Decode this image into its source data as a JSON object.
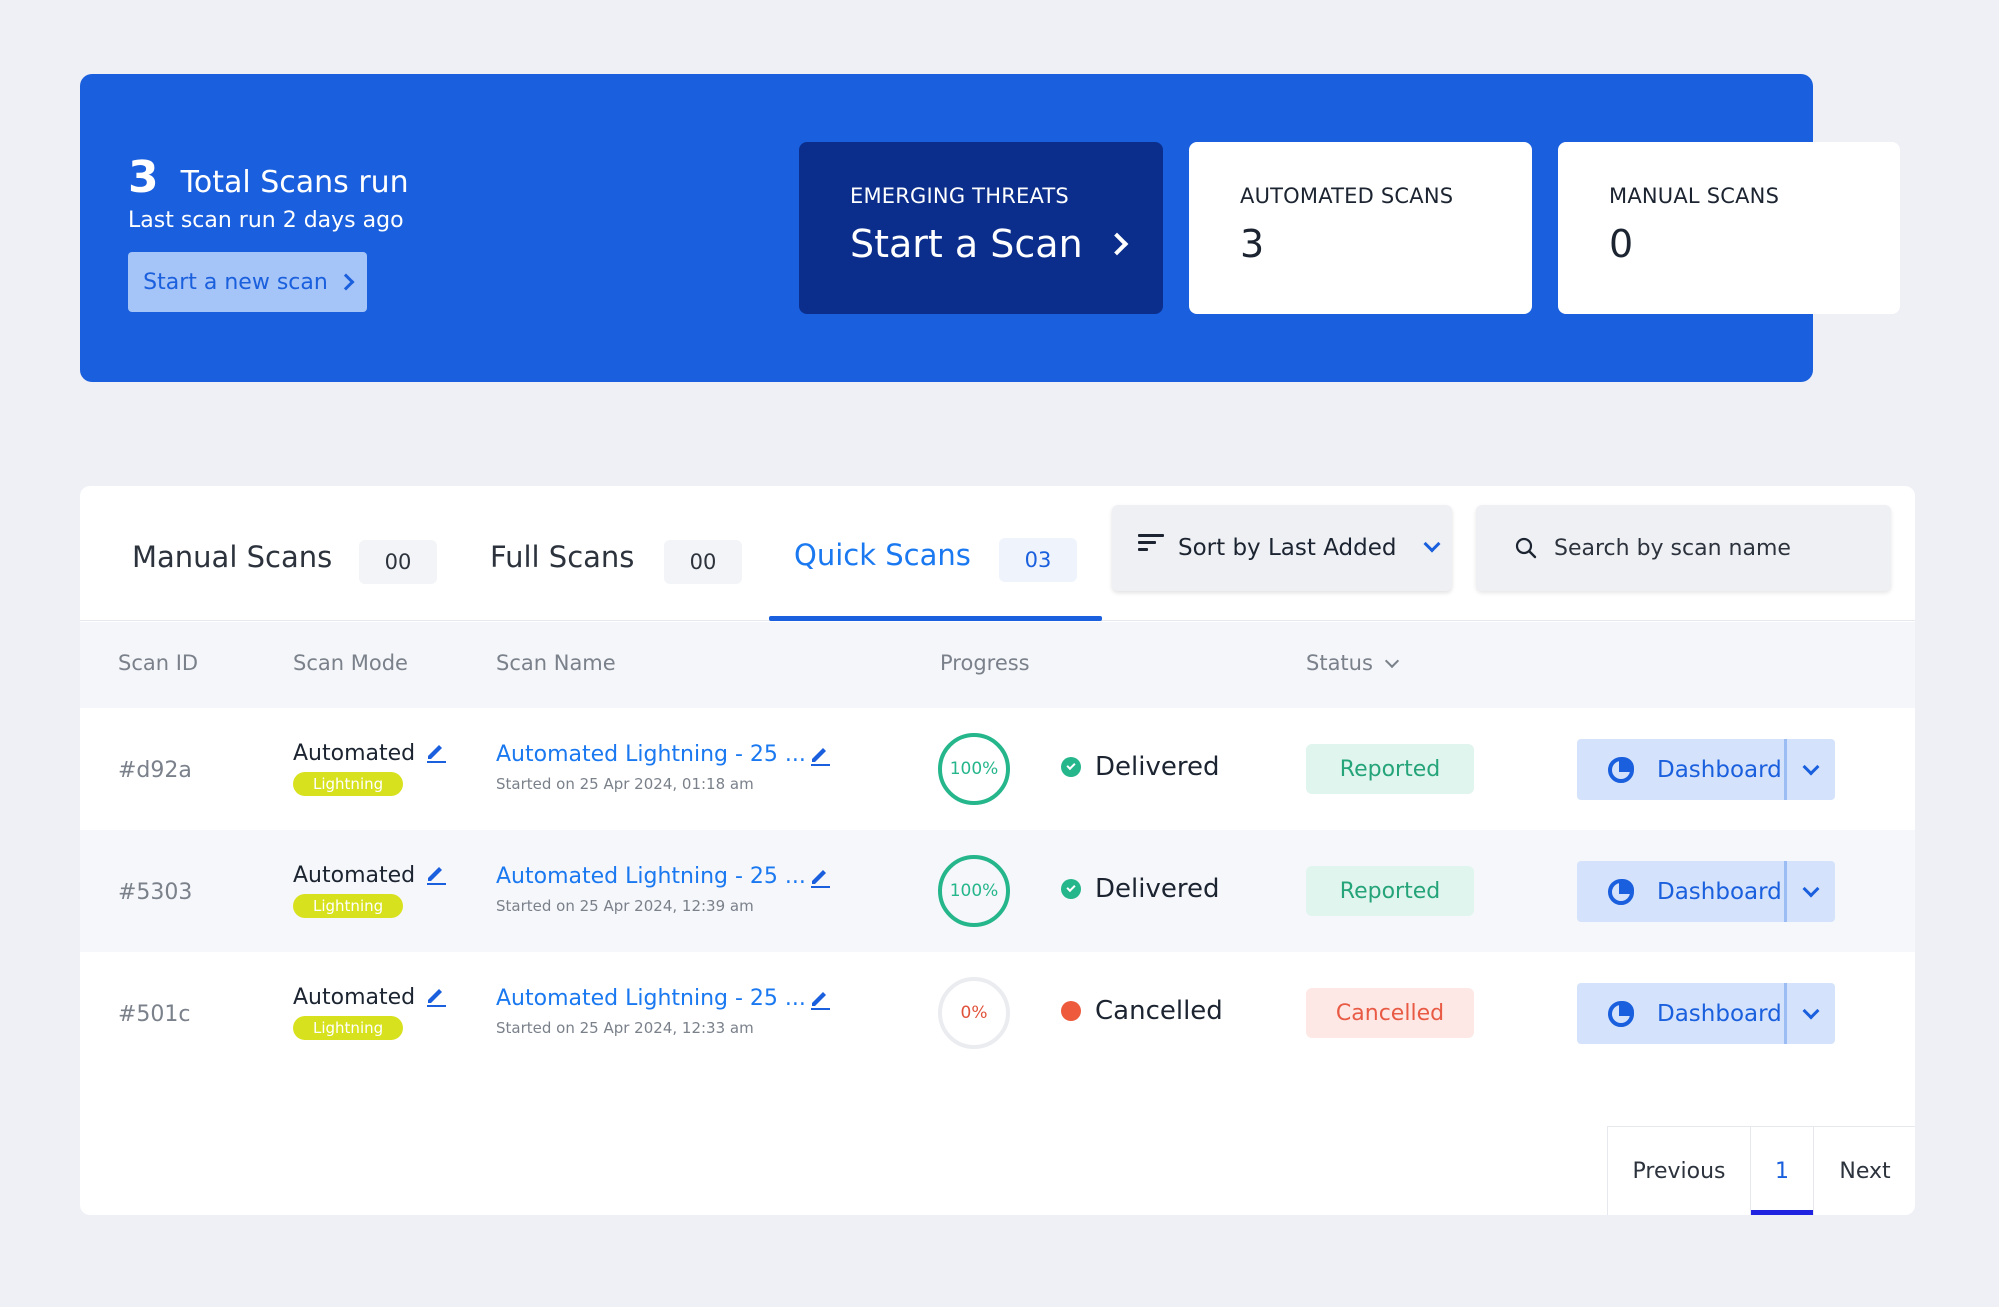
{
  "summary": {
    "total_count": "3",
    "total_label": "Total Scans run",
    "last_run": "Last scan run 2 days ago",
    "new_scan_label": "Start a new scan"
  },
  "cards": {
    "emerging": {
      "title": "EMERGING THREATS",
      "value": "Start a Scan"
    },
    "automated": {
      "title": "AUTOMATED SCANS",
      "value": "3"
    },
    "manual": {
      "title": "MANUAL SCANS",
      "value": "0"
    }
  },
  "tabs": [
    {
      "label": "Manual Scans",
      "count": "00"
    },
    {
      "label": "Full Scans",
      "count": "00"
    },
    {
      "label": "Quick Scans",
      "count": "03",
      "active": true
    }
  ],
  "sort": {
    "label": "Sort by Last Added"
  },
  "search": {
    "placeholder": "Search by scan name"
  },
  "columns": {
    "scan_id": "Scan ID",
    "scan_mode": "Scan Mode",
    "scan_name": "Scan Name",
    "progress": "Progress",
    "status": "Status"
  },
  "rows": [
    {
      "id": "#d92a",
      "mode": "Automated",
      "mode_badge": "Lightning",
      "name": "Automated Lightning - 25 ...",
      "started": "Started on 25 Apr 2024, 01:18 am",
      "progress": "100%",
      "state": "Delivered",
      "status": "Reported",
      "action": "Dashboard"
    },
    {
      "id": "#5303",
      "mode": "Automated",
      "mode_badge": "Lightning",
      "name": "Automated Lightning - 25 ...",
      "started": "Started on 25 Apr 2024, 12:39 am",
      "progress": "100%",
      "state": "Delivered",
      "status": "Reported",
      "action": "Dashboard"
    },
    {
      "id": "#501c",
      "mode": "Automated",
      "mode_badge": "Lightning",
      "name": "Automated Lightning - 25 ...",
      "started": "Started on 25 Apr 2024, 12:33 am",
      "progress": "0%",
      "state": "Cancelled",
      "status": "Cancelled",
      "action": "Dashboard"
    }
  ],
  "pagination": {
    "previous": "Previous",
    "current": "1",
    "next": "Next"
  },
  "colors": {
    "brand_blue": "#1a5fdd",
    "dark_navy": "#0b2e8c",
    "success": "#25b68c",
    "danger": "#ee5a3c",
    "lightning": "#d8e11d"
  }
}
